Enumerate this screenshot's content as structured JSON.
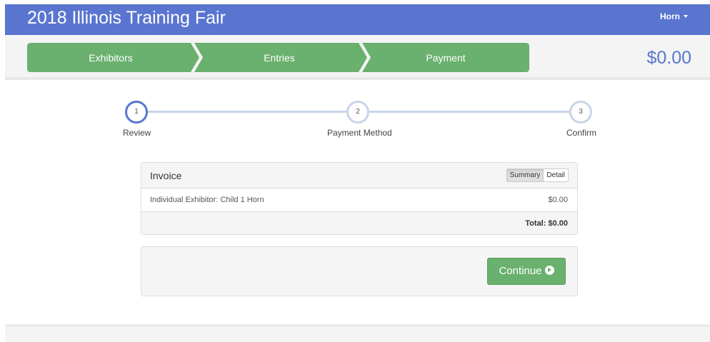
{
  "header": {
    "title": "2018 Illinois Training Fair",
    "user": "Horn"
  },
  "cart_steps": {
    "items": [
      "Exhibitors",
      "Entries",
      "Payment"
    ],
    "total": "$0.00"
  },
  "progress": {
    "steps": [
      {
        "number": "1",
        "label": "Review"
      },
      {
        "number": "2",
        "label": "Payment Method"
      },
      {
        "number": "3",
        "label": "Confirm"
      }
    ]
  },
  "invoice": {
    "title": "Invoice",
    "views": [
      "Summary",
      "Detail"
    ],
    "line": {
      "description": "Individual Exhibitor: Child 1 Horn",
      "amount": "$0.00"
    },
    "total": "Total: $0.00"
  },
  "actions": {
    "continue_label": "Continue"
  },
  "colors": {
    "nav": "#5a75cf",
    "step_green": "#6ab06e",
    "accent": "#5a75cf"
  }
}
